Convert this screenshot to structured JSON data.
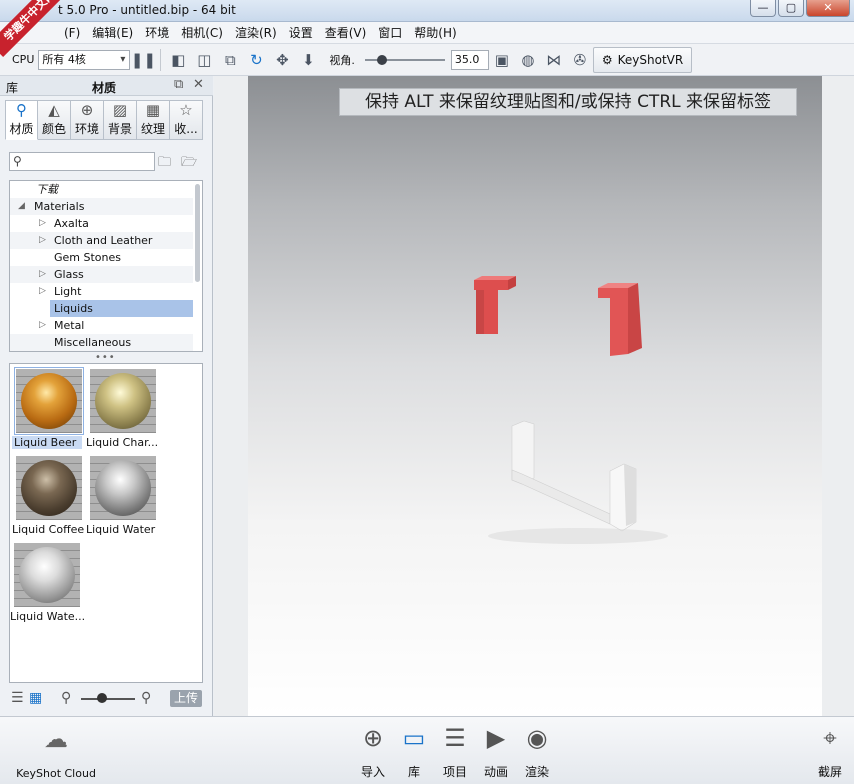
{
  "window": {
    "title": "t 5.0 Pro - untitled.bip - 64 bit",
    "controls": [
      "—",
      "▢",
      "✕"
    ]
  },
  "watermark": "学趣牛中文网",
  "menu": [
    "(F)",
    "编辑(E)",
    "环境",
    "相机(C)",
    "渲染(R)",
    "设置",
    "查看(V)",
    "窗口",
    "帮助(H)"
  ],
  "toolbar": {
    "cpu_label": "CPU",
    "cpu_value": "所有 4核",
    "view_label": "视角.",
    "fov_value": "35.0",
    "vr_label": "KeyShotVR"
  },
  "library": {
    "header_left": "库",
    "header_title": "材质",
    "tabs": [
      {
        "label": "材质",
        "icon": "material-icon"
      },
      {
        "label": "颜色",
        "icon": "color-icon"
      },
      {
        "label": "环境",
        "icon": "globe-icon"
      },
      {
        "label": "背景",
        "icon": "image-icon"
      },
      {
        "label": "纹理",
        "icon": "texture-icon"
      },
      {
        "label": "收...",
        "icon": "star-icon"
      }
    ],
    "search_placeholder": "",
    "tree": [
      {
        "label": "下载",
        "level": 1,
        "arrow": ""
      },
      {
        "label": "Materials",
        "level": 0,
        "arrow": "◢"
      },
      {
        "label": "Axalta",
        "level": 2,
        "arrow": "▷"
      },
      {
        "label": "Cloth and Leather",
        "level": 2,
        "arrow": "▷"
      },
      {
        "label": "Gem Stones",
        "level": 2,
        "arrow": ""
      },
      {
        "label": "Glass",
        "level": 2,
        "arrow": "▷"
      },
      {
        "label": "Light",
        "level": 2,
        "arrow": "▷"
      },
      {
        "label": "Liquids",
        "level": 2,
        "arrow": "",
        "selected": true
      },
      {
        "label": "Metal",
        "level": 2,
        "arrow": "▷"
      },
      {
        "label": "Miscellaneous",
        "level": 2,
        "arrow": ""
      }
    ],
    "materials": [
      {
        "label": "Liquid Beer",
        "color": "#c8841f",
        "selected": true
      },
      {
        "label": "Liquid Char...",
        "color": "#b5a46a"
      },
      {
        "label": "Liquid Coffee",
        "color": "#5a4a3a"
      },
      {
        "label": "Liquid Water",
        "color": "#9a9a9a"
      },
      {
        "label": "Liquid Wate...",
        "color": "#bdbdbd"
      }
    ],
    "upload_label": "上传"
  },
  "viewport": {
    "hint_text": "保持 ALT 来保留纹理贴图和/或保持 CTRL 来保留标签"
  },
  "bottom": {
    "cloud_label": "KeyShot Cloud",
    "buttons": [
      {
        "label": "导入",
        "icon": "import-icon"
      },
      {
        "label": "库",
        "icon": "library-book-icon",
        "active": true
      },
      {
        "label": "项目",
        "icon": "project-icon"
      },
      {
        "label": "动画",
        "icon": "animation-play-icon"
      },
      {
        "label": "渲染",
        "icon": "render-icon"
      }
    ],
    "screenshot_label": "截屏"
  },
  "colors": {
    "accent": "#1a73c9",
    "selection": "#a9c3e8",
    "object_red": "#e05a5a",
    "object_white": "#f4f4f4"
  }
}
